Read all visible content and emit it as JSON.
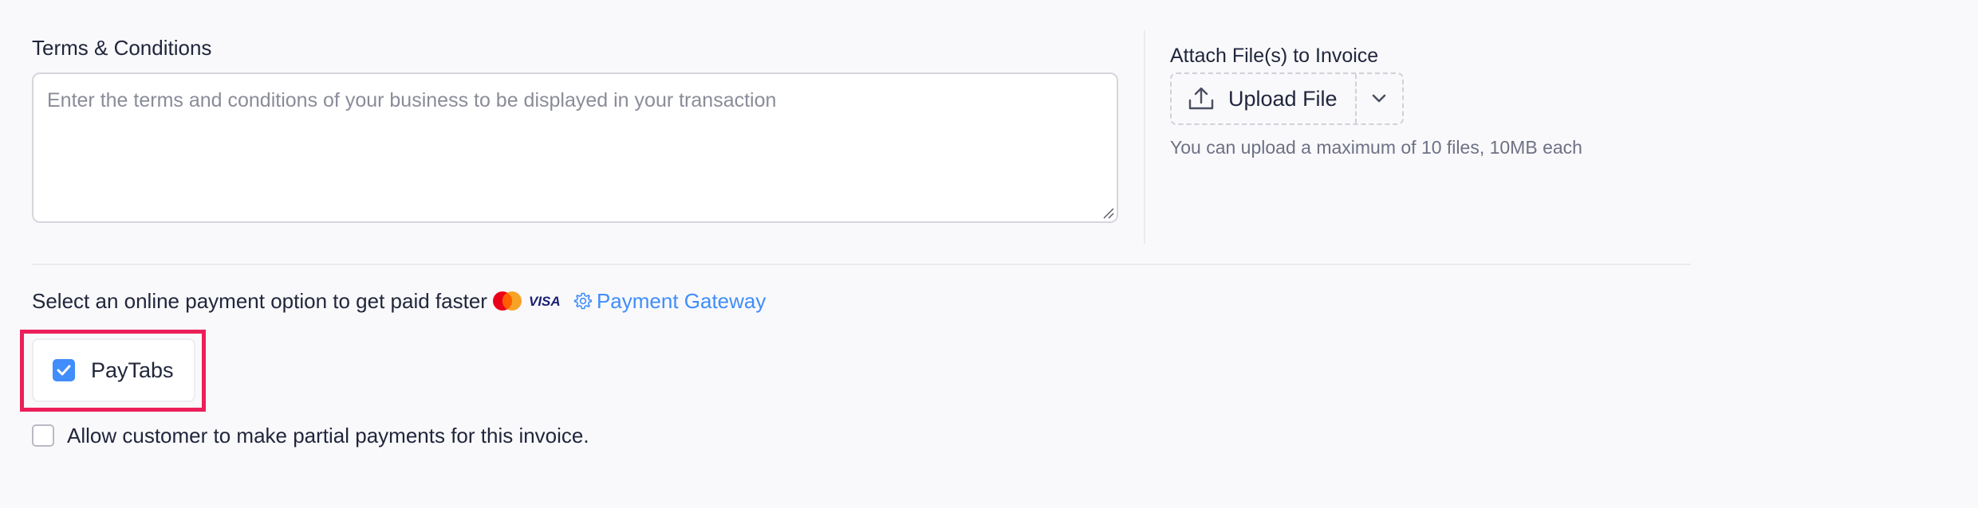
{
  "terms": {
    "label": "Terms & Conditions",
    "value": "",
    "placeholder": "Enter the terms and conditions of your business to be displayed in your transaction"
  },
  "attachments": {
    "label": "Attach File(s) to Invoice",
    "upload_button": "Upload File",
    "hint": "You can upload a maximum of 10 files, 10MB each",
    "icons": {
      "upload": "upload-icon",
      "dropdown": "chevron-down-icon"
    }
  },
  "payment": {
    "prompt": "Select an online payment option to get paid faster",
    "visa_text": "VISA",
    "gateway_link": "Payment Gateway",
    "icons": {
      "card_brand": "mastercard-icon",
      "visa": "visa-icon",
      "settings": "gear-icon"
    },
    "options": [
      {
        "label": "PayTabs",
        "checked": true
      }
    ]
  },
  "partial_payments": {
    "label": "Allow customer to make partial payments for this invoice.",
    "checked": false
  },
  "colors": {
    "accent": "#408dfb",
    "highlight": "#ec1f5a",
    "mastercard_red": "#eb001b",
    "mastercard_orange": "#f79e1b",
    "visa_blue": "#1a1f71",
    "text": "#21263c",
    "muted": "#6e7185"
  }
}
